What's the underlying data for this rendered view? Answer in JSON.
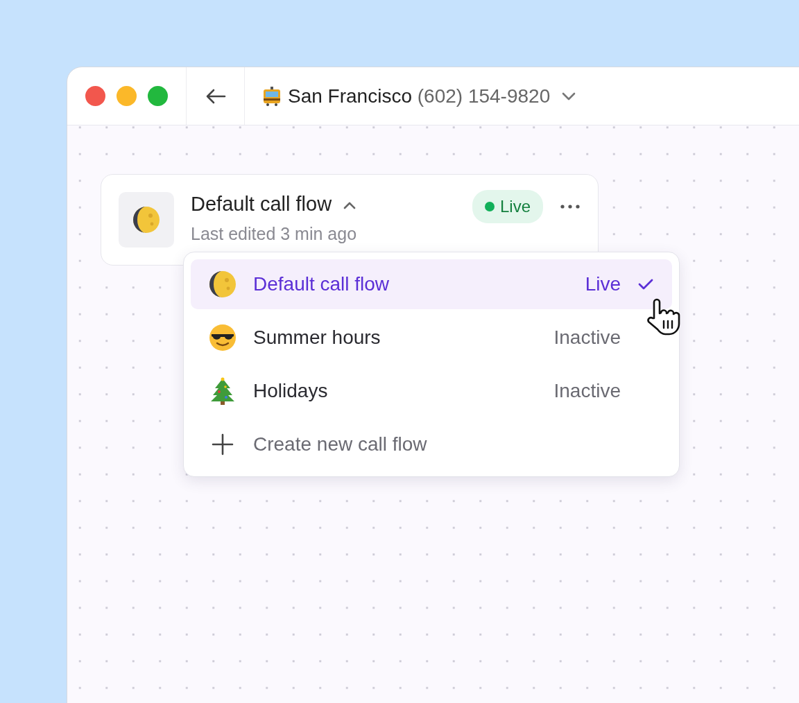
{
  "window": {
    "title": {
      "location": "San Francisco",
      "phone": "(602) 154-9820"
    }
  },
  "flow_card": {
    "title": "Default call flow",
    "expanded": true,
    "subtitle": "Last edited 3 min ago",
    "status": "Live"
  },
  "menu": {
    "items": [
      {
        "kind": "moon",
        "label": "Default call flow",
        "status": "Live",
        "selected": true
      },
      {
        "kind": "sunglasses",
        "label": "Summer hours",
        "status": "Inactive",
        "selected": false
      },
      {
        "kind": "tree",
        "label": "Holidays",
        "status": "Inactive",
        "selected": false
      }
    ],
    "create_label": "Create new call flow"
  }
}
